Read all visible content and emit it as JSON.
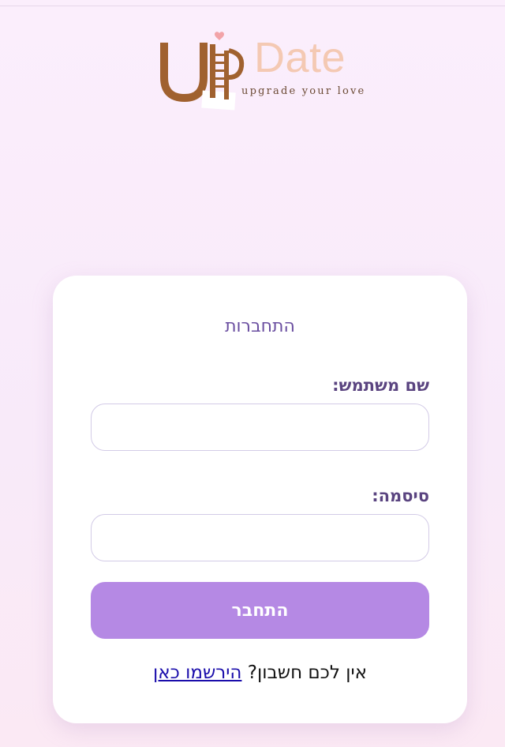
{
  "logo": {
    "initials": "UP",
    "word": "Date",
    "tagline": "upgrade your love"
  },
  "login": {
    "title": "התחברות",
    "username_label": "שם משתמש:",
    "username_value": "",
    "password_label": "סיסמה:",
    "password_value": "",
    "submit_label": "התחבר",
    "no_account_text": "אין לכם חשבון?",
    "register_link": "הירשמו כאן"
  },
  "colors": {
    "page_background": "#fbeefc",
    "logo_brown": "#a0612f",
    "logo_peach": "#f4c9b3",
    "heart_pink": "#f2a3a8",
    "title_purple": "#6a4ea0",
    "label_purple": "#5a4480",
    "button_purple": "#b589e4",
    "link_blue": "#1a0dab"
  },
  "icons": {
    "logo_graphic": "ladder-heart-logo-icon"
  }
}
